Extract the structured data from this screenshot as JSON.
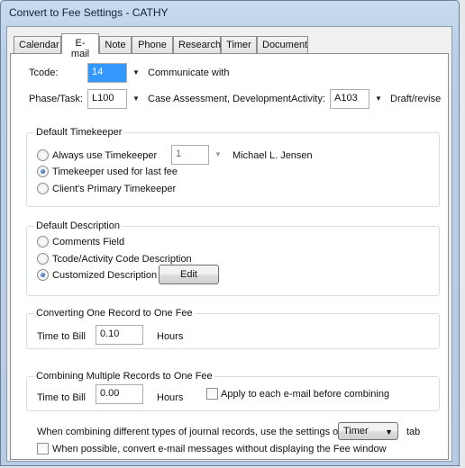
{
  "window": {
    "title": "Convert to Fee Settings - CATHY"
  },
  "tabs": [
    "Calendar",
    "E-mail",
    "Note",
    "Phone",
    "Research",
    "Timer",
    "Document"
  ],
  "active_tab": "E-mail",
  "tcode": {
    "label": "Tcode:",
    "value": "14",
    "description": "Communicate with"
  },
  "phase_task": {
    "label": "Phase/Task:",
    "value": "L100",
    "description": "Case Assessment, Development"
  },
  "activity": {
    "label": "Activity:",
    "value": "A103",
    "description": "Draft/revise"
  },
  "default_timekeeper": {
    "title": "Default Timekeeper",
    "options": [
      "Always use Timekeeper",
      "Timekeeper used for last fee",
      "Client's Primary Timekeeper"
    ],
    "selected": "Timekeeper used for last fee",
    "timekeeper_value": "1",
    "timekeeper_name": "Michael L. Jensen"
  },
  "default_description": {
    "title": "Default Description",
    "options": [
      "Comments Field",
      "Tcode/Activity Code Description",
      "Customized Description"
    ],
    "selected": "Customized Description",
    "edit_label": "Edit"
  },
  "one_record": {
    "title": "Converting One Record to One Fee",
    "time_label": "Time to Bill",
    "time_value": "0.10",
    "unit": "Hours"
  },
  "multiple_records": {
    "title": "Combining Multiple Records to One Fee",
    "time_label": "Time to Bill",
    "time_value": "0.00",
    "unit": "Hours",
    "apply_label": "Apply to each e-mail before combining",
    "apply_checked": false
  },
  "combining_note": {
    "text": "When combining different types of journal records, use the settings on the",
    "tab_select_value": "Timer",
    "suffix": "tab"
  },
  "convert_without_window": {
    "label": "When possible, convert e-mail messages without displaying the Fee window",
    "checked": false
  }
}
